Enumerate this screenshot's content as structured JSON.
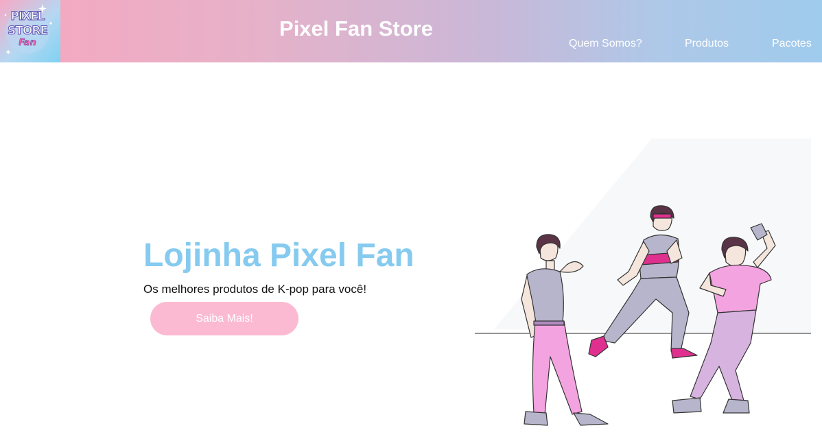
{
  "logo": {
    "line1": "PIXEL",
    "line2": "STORE",
    "line3": "Fan"
  },
  "header": {
    "title": "Pixel Fan Store"
  },
  "nav": {
    "items": [
      "Quem Somos?",
      "Produtos",
      "Pacotes"
    ]
  },
  "hero": {
    "title": "Lojinha Pixel Fan",
    "subtitle": "Os melhores produtos de K-pop para você!",
    "cta_label": "Saiba Mais!"
  },
  "colors": {
    "accent_blue": "#86cbef",
    "accent_pink": "#fbbad2",
    "header_gradient_start": "#f6a8bf",
    "header_gradient_end": "#9fcbec"
  },
  "illustration": {
    "subject": "three-dancers"
  }
}
